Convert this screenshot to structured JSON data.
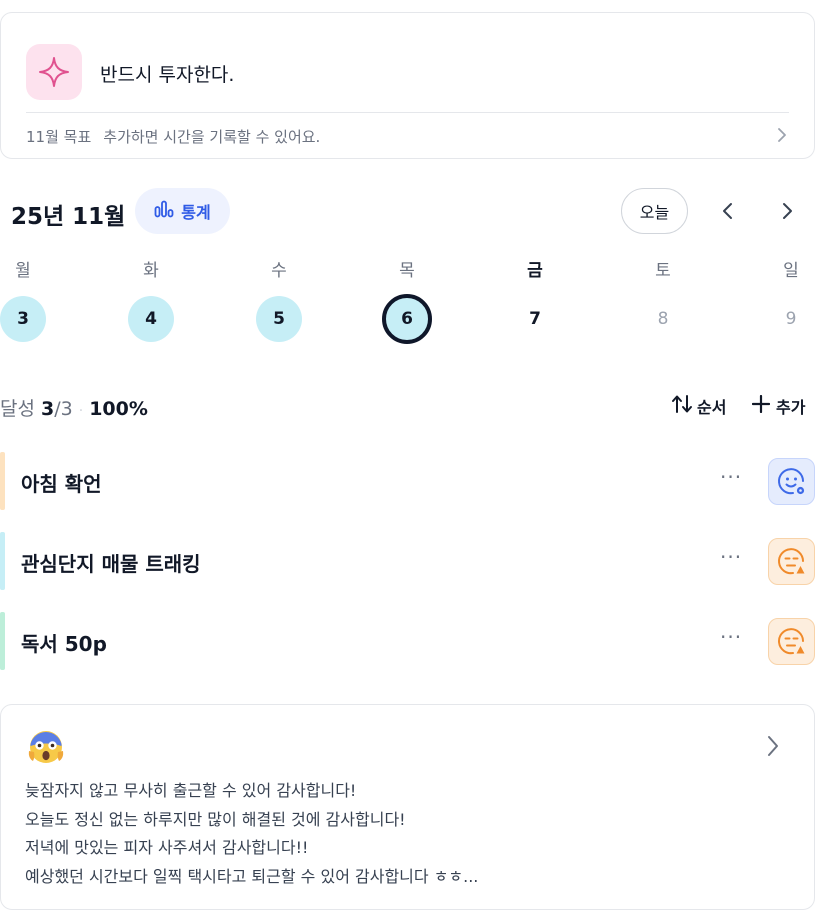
{
  "goal": {
    "title": "반드시 투자한다.",
    "month_label": "11월 목표",
    "hint": "추가하면 시간을 기록할 수 있어요.",
    "icon": "sparkle-icon"
  },
  "calendar": {
    "month_title": "25년 11월",
    "stats_label": "통계",
    "today_label": "오늘",
    "weekdays": [
      "월",
      "화",
      "수",
      "목",
      "금",
      "토",
      "일"
    ],
    "days": [
      {
        "num": "3",
        "state": "done"
      },
      {
        "num": "4",
        "state": "done"
      },
      {
        "num": "5",
        "state": "done"
      },
      {
        "num": "6",
        "state": "today"
      },
      {
        "num": "7",
        "state": "plain"
      },
      {
        "num": "8",
        "state": "future"
      },
      {
        "num": "9",
        "state": "future"
      }
    ]
  },
  "progress": {
    "label": "달성",
    "done": "3",
    "total": "/3",
    "percent": "100%",
    "order_label": "순서",
    "add_label": "추가"
  },
  "habits": [
    {
      "name": "아침 확언",
      "more": "···",
      "bar_color": "#fde2bf",
      "mood": "blue",
      "mood_icon": "smile-face-icon"
    },
    {
      "name": "관심단지 매물 트래킹",
      "more": "···",
      "bar_color": "#c6eef6",
      "mood": "orange",
      "mood_icon": "neutral-face-icon"
    },
    {
      "name": "독서 50p",
      "more": "···",
      "bar_color": "#bdeed9",
      "mood": "orange",
      "mood_icon": "neutral-face-icon"
    }
  ],
  "journal": {
    "emoji": "screaming-face-emoji",
    "lines": [
      "늦잠자지 않고 무사히 출근할 수 있어 감사합니다!",
      "오늘도 정신 없는 하루지만 많이 해결된 것에 감사합니다!",
      "저녁에 맛있는 피자 사주셔서 감사합니다!!",
      "예상했던 시간보다 일찍 택시타고 퇴근할 수 있어 감사합니다 ㅎㅎ..."
    ]
  },
  "colors": {
    "accent_blue": "#2f5be6",
    "done_day_bg": "#c6eef6",
    "goal_icon_bg": "#fde2ee",
    "goal_icon_stroke": "#e0528f",
    "mood_blue": "#3e6ae8",
    "mood_orange": "#f08a2a"
  }
}
